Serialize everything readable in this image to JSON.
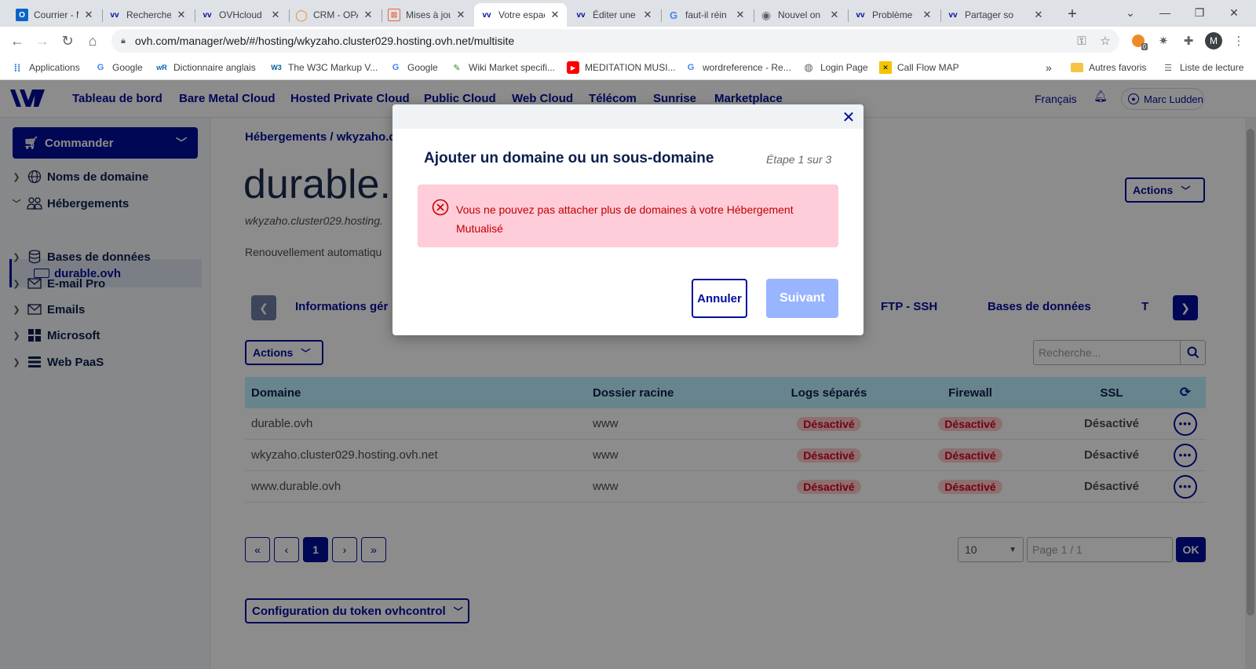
{
  "browser": {
    "tabs": [
      {
        "title": "Courrier - Marc",
        "favicon": "outlook-icon"
      },
      {
        "title": "Recherche",
        "favicon": "ovh-icon"
      },
      {
        "title": "OVHcloud",
        "favicon": "ovh-icon"
      },
      {
        "title": "CRM - OPA",
        "favicon": "crm-icon"
      },
      {
        "title": "Mises à jour",
        "favicon": "mises-icon"
      },
      {
        "title": "Votre espace",
        "favicon": "ovh-icon"
      },
      {
        "title": "Éditer une",
        "favicon": "ovh-icon"
      },
      {
        "title": "faut-il réin",
        "favicon": "google-icon"
      },
      {
        "title": "Nouvel on",
        "favicon": "chrome-icon"
      },
      {
        "title": "Problème",
        "favicon": "ovh-icon"
      },
      {
        "title": "Partager so",
        "favicon": "ovh-icon"
      }
    ],
    "url": "ovh.com/manager/web/#/hosting/wkyzaho.cluster029.hosting.ovh.net/multisite",
    "profile_initial": "M",
    "extension_badge": "0",
    "bookmarks": [
      {
        "label": "Applications"
      },
      {
        "label": "Google"
      },
      {
        "label": "Dictionnaire anglais"
      },
      {
        "label": "The W3C Markup V..."
      },
      {
        "label": "Google"
      },
      {
        "label": "Wiki Market specifi..."
      },
      {
        "label": "MEDITATION MUSI..."
      },
      {
        "label": "wordreference - Re..."
      },
      {
        "label": "Login Page"
      },
      {
        "label": "Call Flow MAP"
      }
    ],
    "bookmarks_overflow": "»",
    "other_bookmarks": "Autres favoris",
    "reading_list": "Liste de lecture"
  },
  "header": {
    "nav": [
      "Tableau de bord",
      "Bare Metal Cloud",
      "Hosted Private Cloud",
      "Public Cloud",
      "Web Cloud",
      "Télécom",
      "Sunrise",
      "Marketplace"
    ],
    "language": "Français",
    "user": "Marc Ludden"
  },
  "sidebar": {
    "order_label": "Commander",
    "items": [
      {
        "label": "Noms de domaine",
        "icon": "globe-icon",
        "expanded": false
      },
      {
        "label": "Hébergements",
        "icon": "people-icon",
        "expanded": true
      },
      {
        "label": "Bases de données",
        "icon": "database-icon",
        "expanded": false
      },
      {
        "label": "E-mail Pro",
        "icon": "mail-icon",
        "expanded": false
      },
      {
        "label": "Emails",
        "icon": "mail-icon",
        "expanded": false
      },
      {
        "label": "Microsoft",
        "icon": "windows-icon",
        "expanded": false
      },
      {
        "label": "Web PaaS",
        "icon": "layers-icon",
        "expanded": false
      }
    ],
    "selected_sub": "durable.ovh"
  },
  "main": {
    "breadcrumb": "Hébergements / wkyzaho.c",
    "title": "durable.c",
    "subtitle": "wkyzaho.cluster029.hosting.",
    "renewal": "Renouvellement automatiqu",
    "actions_label": "Actions",
    "tabs": [
      "Informations gér",
      "FTP - SSH",
      "Bases de données",
      "T"
    ],
    "search_placeholder": "Recherche...",
    "table": {
      "headers": [
        "Domaine",
        "Dossier racine",
        "Logs séparés",
        "Firewall",
        "SSL"
      ],
      "rows": [
        {
          "domain": "durable.ovh",
          "root": "www",
          "logs": "Désactivé",
          "firewall": "Désactivé",
          "ssl": "Désactivé"
        },
        {
          "domain": "wkyzaho.cluster029.hosting.ovh.net",
          "root": "www",
          "logs": "Désactivé",
          "firewall": "Désactivé",
          "ssl": "Désactivé"
        },
        {
          "domain": "www.durable.ovh",
          "root": "www",
          "logs": "Désactivé",
          "firewall": "Désactivé",
          "ssl": "Désactivé"
        }
      ]
    },
    "pagination": {
      "current": "1",
      "per_page": "10",
      "page_placeholder": "Page 1 / 1",
      "ok": "OK"
    },
    "token_label": "Configuration du token ovhcontrol"
  },
  "modal": {
    "title": "Ajouter un domaine ou un sous-domaine",
    "step": "Étape 1 sur 3",
    "error": "Vous ne pouvez pas attacher plus de domaines à votre Hébergement Mutualisé",
    "cancel": "Annuler",
    "next": "Suivant"
  },
  "colors": {
    "brand": "#000e9c",
    "table_header": "#bef1ff",
    "alert_bg": "#ffccd9",
    "alert_text": "#c20000",
    "badge_bg": "#ffcccc",
    "badge_text": "#d4001f",
    "next_disabled": "#99b5ff"
  }
}
